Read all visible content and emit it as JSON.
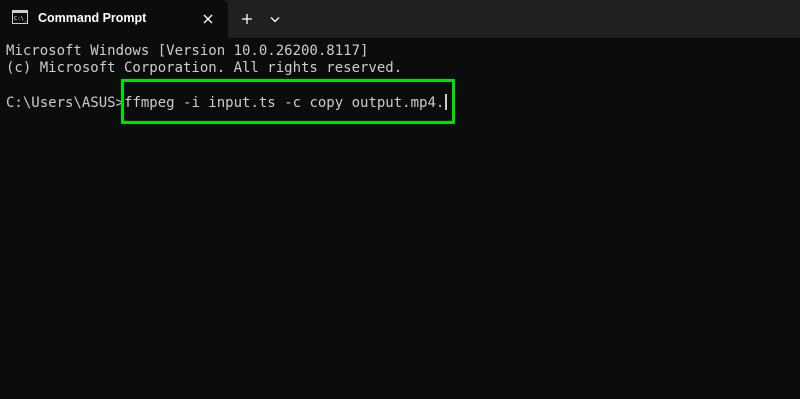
{
  "tab": {
    "title": "Command Prompt",
    "icon": "cmd-icon",
    "close_icon": "close-icon"
  },
  "tabbar": {
    "new_tab_icon": "plus-icon",
    "dropdown_icon": "chevron-down-icon"
  },
  "terminal": {
    "lines": [
      "Microsoft Windows [Version 10.0.26200.8117]",
      "(c) Microsoft Corporation. All rights reserved."
    ],
    "prompt": "C:\\Users\\ASUS>",
    "command": "ffmpeg -i input.ts -c copy output.mp4."
  },
  "colors": {
    "background": "#0c0c0c",
    "tabbar": "#202020",
    "text": "#cccccc",
    "highlight": "#00e000"
  }
}
